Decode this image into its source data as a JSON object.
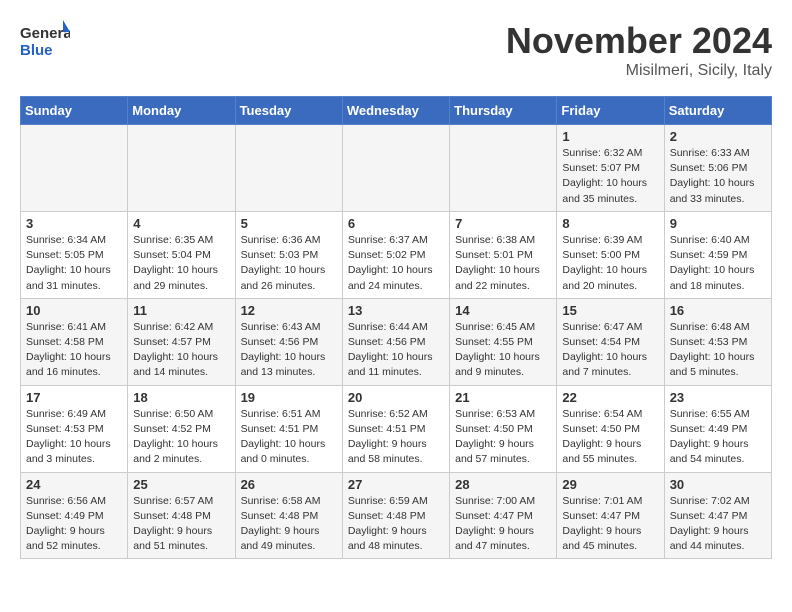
{
  "header": {
    "logo_general": "General",
    "logo_blue": "Blue",
    "month_year": "November 2024",
    "location": "Misilmeri, Sicily, Italy"
  },
  "weekdays": [
    "Sunday",
    "Monday",
    "Tuesday",
    "Wednesday",
    "Thursday",
    "Friday",
    "Saturday"
  ],
  "weeks": [
    [
      {
        "day": "",
        "info": ""
      },
      {
        "day": "",
        "info": ""
      },
      {
        "day": "",
        "info": ""
      },
      {
        "day": "",
        "info": ""
      },
      {
        "day": "",
        "info": ""
      },
      {
        "day": "1",
        "info": "Sunrise: 6:32 AM\nSunset: 5:07 PM\nDaylight: 10 hours and 35 minutes."
      },
      {
        "day": "2",
        "info": "Sunrise: 6:33 AM\nSunset: 5:06 PM\nDaylight: 10 hours and 33 minutes."
      }
    ],
    [
      {
        "day": "3",
        "info": "Sunrise: 6:34 AM\nSunset: 5:05 PM\nDaylight: 10 hours and 31 minutes."
      },
      {
        "day": "4",
        "info": "Sunrise: 6:35 AM\nSunset: 5:04 PM\nDaylight: 10 hours and 29 minutes."
      },
      {
        "day": "5",
        "info": "Sunrise: 6:36 AM\nSunset: 5:03 PM\nDaylight: 10 hours and 26 minutes."
      },
      {
        "day": "6",
        "info": "Sunrise: 6:37 AM\nSunset: 5:02 PM\nDaylight: 10 hours and 24 minutes."
      },
      {
        "day": "7",
        "info": "Sunrise: 6:38 AM\nSunset: 5:01 PM\nDaylight: 10 hours and 22 minutes."
      },
      {
        "day": "8",
        "info": "Sunrise: 6:39 AM\nSunset: 5:00 PM\nDaylight: 10 hours and 20 minutes."
      },
      {
        "day": "9",
        "info": "Sunrise: 6:40 AM\nSunset: 4:59 PM\nDaylight: 10 hours and 18 minutes."
      }
    ],
    [
      {
        "day": "10",
        "info": "Sunrise: 6:41 AM\nSunset: 4:58 PM\nDaylight: 10 hours and 16 minutes."
      },
      {
        "day": "11",
        "info": "Sunrise: 6:42 AM\nSunset: 4:57 PM\nDaylight: 10 hours and 14 minutes."
      },
      {
        "day": "12",
        "info": "Sunrise: 6:43 AM\nSunset: 4:56 PM\nDaylight: 10 hours and 13 minutes."
      },
      {
        "day": "13",
        "info": "Sunrise: 6:44 AM\nSunset: 4:56 PM\nDaylight: 10 hours and 11 minutes."
      },
      {
        "day": "14",
        "info": "Sunrise: 6:45 AM\nSunset: 4:55 PM\nDaylight: 10 hours and 9 minutes."
      },
      {
        "day": "15",
        "info": "Sunrise: 6:47 AM\nSunset: 4:54 PM\nDaylight: 10 hours and 7 minutes."
      },
      {
        "day": "16",
        "info": "Sunrise: 6:48 AM\nSunset: 4:53 PM\nDaylight: 10 hours and 5 minutes."
      }
    ],
    [
      {
        "day": "17",
        "info": "Sunrise: 6:49 AM\nSunset: 4:53 PM\nDaylight: 10 hours and 3 minutes."
      },
      {
        "day": "18",
        "info": "Sunrise: 6:50 AM\nSunset: 4:52 PM\nDaylight: 10 hours and 2 minutes."
      },
      {
        "day": "19",
        "info": "Sunrise: 6:51 AM\nSunset: 4:51 PM\nDaylight: 10 hours and 0 minutes."
      },
      {
        "day": "20",
        "info": "Sunrise: 6:52 AM\nSunset: 4:51 PM\nDaylight: 9 hours and 58 minutes."
      },
      {
        "day": "21",
        "info": "Sunrise: 6:53 AM\nSunset: 4:50 PM\nDaylight: 9 hours and 57 minutes."
      },
      {
        "day": "22",
        "info": "Sunrise: 6:54 AM\nSunset: 4:50 PM\nDaylight: 9 hours and 55 minutes."
      },
      {
        "day": "23",
        "info": "Sunrise: 6:55 AM\nSunset: 4:49 PM\nDaylight: 9 hours and 54 minutes."
      }
    ],
    [
      {
        "day": "24",
        "info": "Sunrise: 6:56 AM\nSunset: 4:49 PM\nDaylight: 9 hours and 52 minutes."
      },
      {
        "day": "25",
        "info": "Sunrise: 6:57 AM\nSunset: 4:48 PM\nDaylight: 9 hours and 51 minutes."
      },
      {
        "day": "26",
        "info": "Sunrise: 6:58 AM\nSunset: 4:48 PM\nDaylight: 9 hours and 49 minutes."
      },
      {
        "day": "27",
        "info": "Sunrise: 6:59 AM\nSunset: 4:48 PM\nDaylight: 9 hours and 48 minutes."
      },
      {
        "day": "28",
        "info": "Sunrise: 7:00 AM\nSunset: 4:47 PM\nDaylight: 9 hours and 47 minutes."
      },
      {
        "day": "29",
        "info": "Sunrise: 7:01 AM\nSunset: 4:47 PM\nDaylight: 9 hours and 45 minutes."
      },
      {
        "day": "30",
        "info": "Sunrise: 7:02 AM\nSunset: 4:47 PM\nDaylight: 9 hours and 44 minutes."
      }
    ]
  ]
}
